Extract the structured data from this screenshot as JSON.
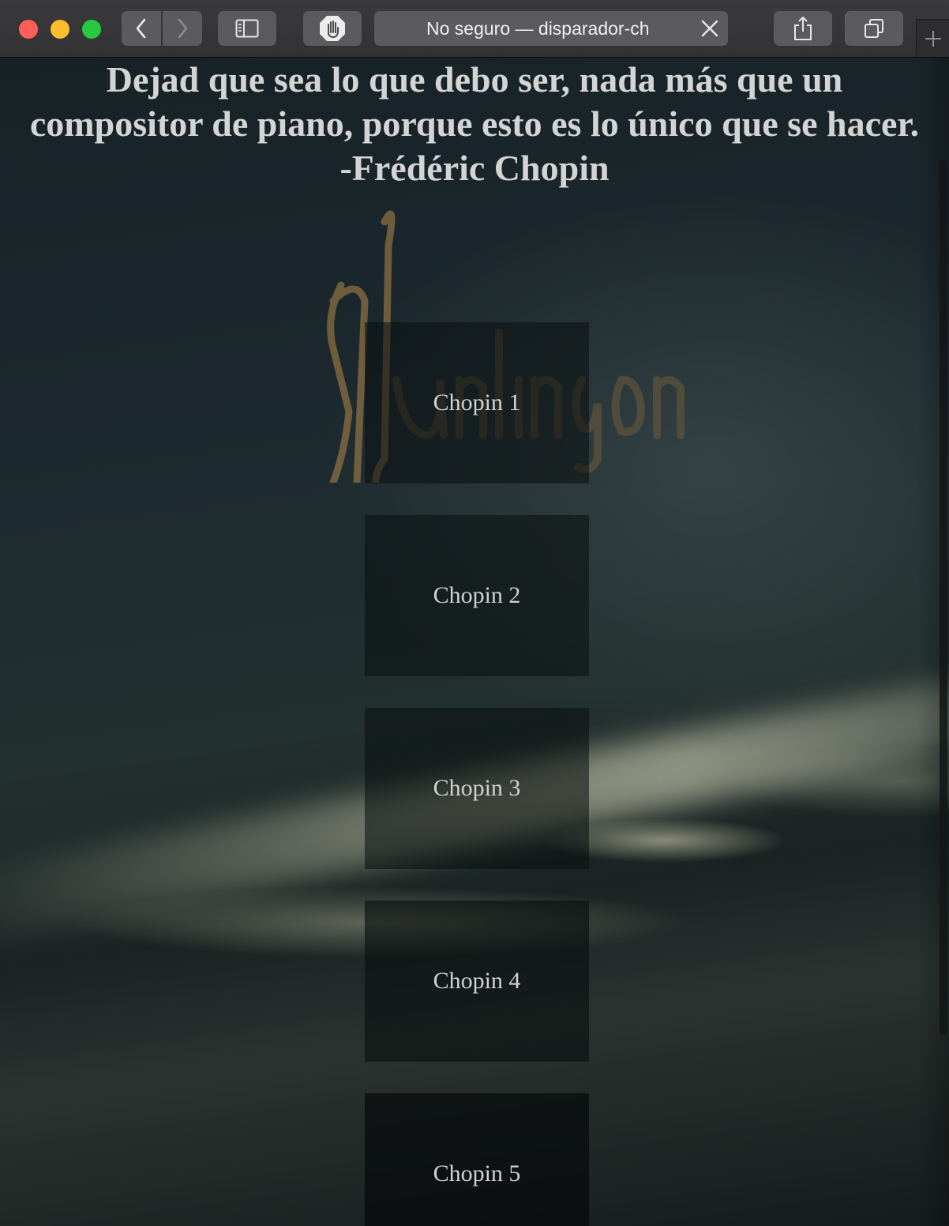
{
  "browser": {
    "address": "No seguro — disparador-ch",
    "buttons": {
      "back": "chevron-left-icon",
      "forward": "chevron-right-icon",
      "sidebar": "sidebar-icon",
      "content_blocker": "hand-icon",
      "close": "close-icon",
      "share": "share-icon",
      "tabs": "tabs-icon",
      "new_tab": "plus-icon"
    },
    "colors": {
      "close": "#fe5f57",
      "minimize": "#febc2e",
      "zoom": "#28c840"
    }
  },
  "page": {
    "quote": {
      "line1": "Dejad que sea lo que debo ser, nada más que un",
      "line2": "compositor de piano, porque esto es lo único que se hacer.",
      "line3": "-Frédéric Chopin"
    },
    "tiles": [
      {
        "label": "Chopin 1"
      },
      {
        "label": "Chopin 2"
      },
      {
        "label": "Chopin 3"
      },
      {
        "label": "Chopin 4"
      },
      {
        "label": "Chopin 5"
      }
    ]
  }
}
